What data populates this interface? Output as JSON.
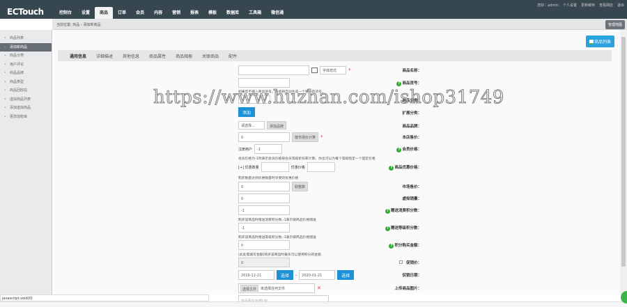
{
  "header": {
    "logo": "ECTouch",
    "nav": [
      "控制台",
      "设置",
      "商品",
      "订单",
      "会员",
      "内容",
      "营销",
      "报表",
      "模板",
      "数据库",
      "工具箱",
      "微信通"
    ],
    "active_nav": 2,
    "user": [
      "您好：admin",
      "个人设置",
      "更新缓存",
      "查看网店",
      "退出"
    ]
  },
  "breadcrumb": {
    "text": "当前位置: 商品 › 添加新商品",
    "button": "管理地图"
  },
  "sidebar": {
    "items": [
      "商品列表",
      "添加新商品",
      "商品分类",
      "用户评论",
      "商品品牌",
      "商品类型",
      "商品回收站",
      "虚拟商品列表",
      "添加虚拟商品",
      "更改加密串"
    ],
    "active": 1
  },
  "main": {
    "list_button": "商品列表",
    "tabs": [
      "通用信息",
      "详细描述",
      "其他信息",
      "商品属性",
      "商品相册",
      "关联商品",
      "配件"
    ],
    "form": {
      "name_label": "商品名称：",
      "font_style": "字体样式",
      "sn_label": "商品货号：",
      "sn_hint": "如果您不输入商品货号，系统将自动生成一个唯一的货号。",
      "cat_label": "商品分类：",
      "ext_cat_label": "扩展分类：",
      "add": "添加",
      "brand_label": "商品品牌：",
      "brand_select": "请选择...",
      "add_brand": "添加品牌",
      "shop_price_label": "本店售价：",
      "shop_price": "0",
      "by_market": "按市场价计算",
      "member_price_label": "会员价格：",
      "member_reg": "注册用户",
      "member_val": "-1",
      "member_hint": "会员价格为-1时表示会员价格按会员等级折扣率计算。你也可以为每个等级指定一个固定价格",
      "volume_label": "商品优惠价格：",
      "volume_add": "[+] 优惠数量",
      "volume_price": "优惠价格",
      "volume_hint": "购买数量达到优惠数量时享受的优惠价格",
      "market_label": "市场售价：",
      "market_val": "0",
      "round": "取整数",
      "virtual_label": "虚拟销量：",
      "virtual_val": "0",
      "give_label": "赠送消费积分数：",
      "give_val": "-1",
      "give_hint": "购买该商品时赠送消费积分数,-1表示按商品价格赠送",
      "rank_label": "赠送等级积分数：",
      "rank_val": "-1",
      "rank_hint": "购买该商品时赠送等级积分数,-1表示按商品价格赠送",
      "integral_label": "积分购买金额：",
      "integral_val": "0",
      "integral_hint": "(此处需填写金额)购买该商品时最多可以使用积分的金额",
      "promote_label": "促销价：",
      "promote_val": "0",
      "promote_date_label": "促销日期：",
      "start": "2019-12-21",
      "end": "2020-01-21",
      "choose": "选择",
      "img_label": "上传商品图片：",
      "file_btn": "选择文件",
      "no_file": "未选择任何文件",
      "img_url_ph": "商品图片外部URL"
    }
  },
  "watermark": "https://www.huzhan.com/ishop31749",
  "status": "javascript:void(0)"
}
